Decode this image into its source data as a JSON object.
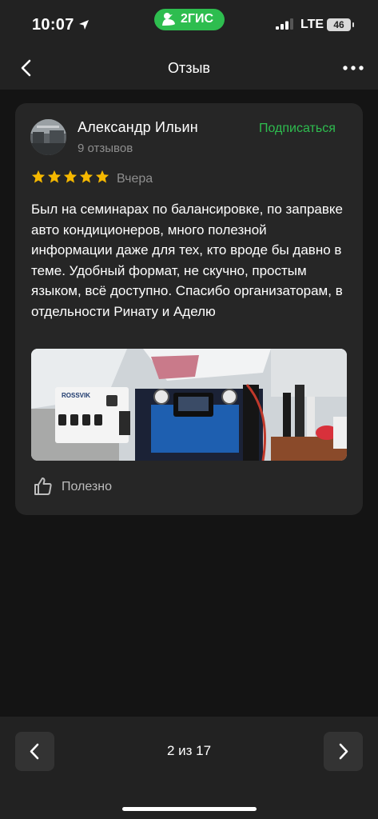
{
  "status_bar": {
    "time": "10:07",
    "brand_label": "2ГИС",
    "network": "LTE",
    "battery_level": "46",
    "location_icon": "location-arrow-icon",
    "brand_color": "#2ebd4f"
  },
  "header": {
    "title": "Отзыв",
    "back_icon": "chevron-left-icon",
    "more_icon": "more-dots-icon"
  },
  "review": {
    "author": "Александр Ильин",
    "reviews_count": "9 отзывов",
    "subscribe_label": "Подписаться",
    "rating": 5,
    "rating_max": 5,
    "date": "Вчера",
    "text": "Был на семинарах по балансировке, по заправке авто кондиционеров, много полезной информации даже для тех, кто вроде бы давно в теме. Удобный формат, не скучно, простым языком, всё доступно. Спасибо организаторам, в отдельности Ринату и Аделю",
    "photo_label": "ROSSVIK",
    "helpful_label": "Полезно",
    "star_color": "#f5b800",
    "accent_color": "#2ebd4f"
  },
  "pager": {
    "label": "2 из 17",
    "prev_icon": "chevron-left-icon",
    "next_icon": "chevron-right-icon"
  }
}
